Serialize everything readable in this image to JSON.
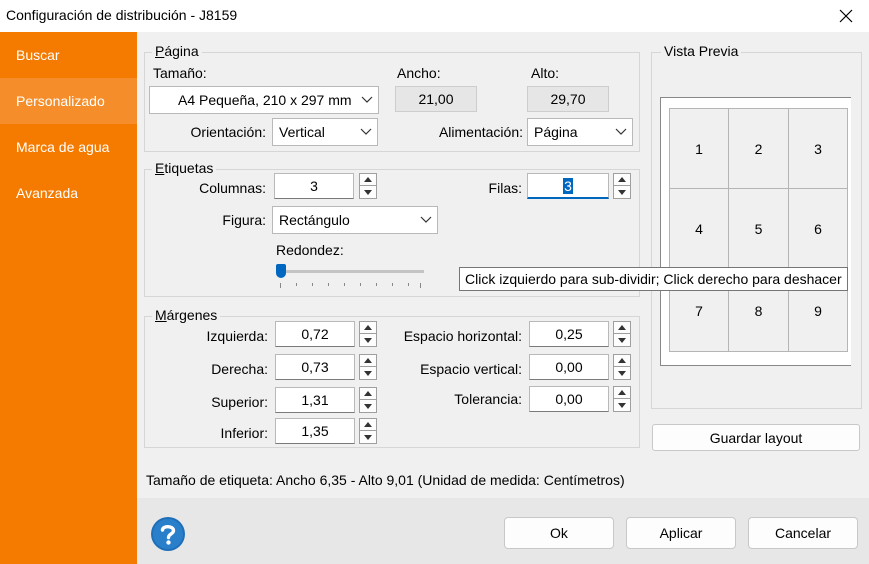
{
  "window": {
    "title": "Configuración de distribución - J8159"
  },
  "sidebar": {
    "items": [
      {
        "label": "Buscar"
      },
      {
        "label": "Personalizado"
      },
      {
        "label": "Marca de agua"
      },
      {
        "label": "Avanzada"
      }
    ],
    "active_index": 1
  },
  "page_group": {
    "legend_u": "P",
    "legend_rest": "ágina",
    "size_label": "Tamaño:",
    "size_value": "A4 Pequeña, 210 x 297 mm",
    "width_label": "Ancho:",
    "width_value": "21,00",
    "height_label": "Alto:",
    "height_value": "29,70",
    "orientation_label": "Orientación:",
    "orientation_value": "Vertical",
    "feed_label": "Alimentación:",
    "feed_value": "Página"
  },
  "labels_group": {
    "legend_u": "E",
    "legend_rest": "tiquetas",
    "columns_label": "Columnas:",
    "columns_value": "3",
    "rows_label": "Filas:",
    "rows_value": "3",
    "shape_label": "Figura:",
    "shape_value": "Rectángulo",
    "roundness_label": "Redondez:",
    "roundness_fraction": 0
  },
  "margins_group": {
    "legend_u": "M",
    "legend_rest": "árgenes",
    "left_label": "Izquierda:",
    "left_value": "0,72",
    "right_label": "Derecha:",
    "right_value": "0,73",
    "top_label": "Superior:",
    "top_value": "1,31",
    "bottom_label": "Inferior:",
    "bottom_value": "1,35",
    "hspace_label": "Espacio horizontal:",
    "hspace_value": "0,25",
    "vspace_label": "Espacio vertical:",
    "vspace_value": "0,00",
    "tolerance_label": "Tolerancia:",
    "tolerance_value": "0,00"
  },
  "preview": {
    "legend": "Vista Previa",
    "cells": [
      "1",
      "2",
      "3",
      "4",
      "5",
      "6",
      "7",
      "8",
      "9"
    ],
    "save_layout_label": "Guardar layout"
  },
  "tooltip": {
    "text": "Click izquierdo para sub-dividir; Click derecho para deshacer"
  },
  "status": {
    "text": "Tamaño de etiqueta: Ancho 6,35 - Alto 9,01 (Unidad de medida: Centímetros)"
  },
  "footer": {
    "ok_label": "Ok",
    "apply_label": "Aplicar",
    "cancel_label": "Cancelar"
  },
  "colors": {
    "sidebar": "#f47a00",
    "accent": "#0067c0",
    "help": "#1f6fb8"
  }
}
